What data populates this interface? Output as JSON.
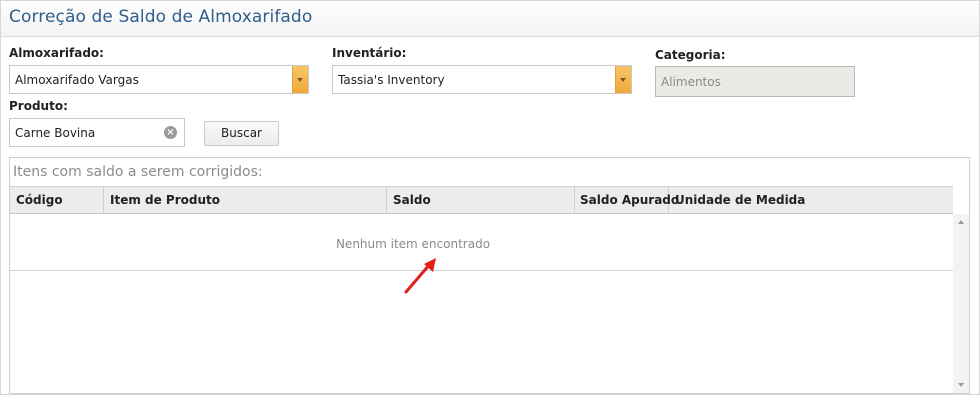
{
  "window": {
    "title": "Correção de Saldo de Almoxarifado"
  },
  "filters": {
    "almoxarifado": {
      "label": "Almoxarifado:",
      "value": "Almoxarifado Vargas"
    },
    "inventario": {
      "label": "Inventário:",
      "value": "Tassia's Inventory"
    },
    "categoria": {
      "label": "Categoria:",
      "value": "Alimentos"
    },
    "produto": {
      "label": "Produto:",
      "value": "Carne Bovina"
    },
    "search_button": "Buscar"
  },
  "grid": {
    "caption": "Itens com saldo a serem corrigidos:",
    "columns": [
      "Código",
      "Item de Produto",
      "Saldo",
      "Saldo Apurado",
      "Unidade de Medida"
    ],
    "empty_message": "Nenhum item encontrado"
  },
  "colors": {
    "title": "#2f5d8c",
    "dropdown_button": "#f0a93a",
    "annotation_arrow": "#e3201b"
  },
  "icons": {
    "dropdown": "chevron-down-icon",
    "clear": "clear-icon",
    "annotation": "red-arrow-icon"
  }
}
